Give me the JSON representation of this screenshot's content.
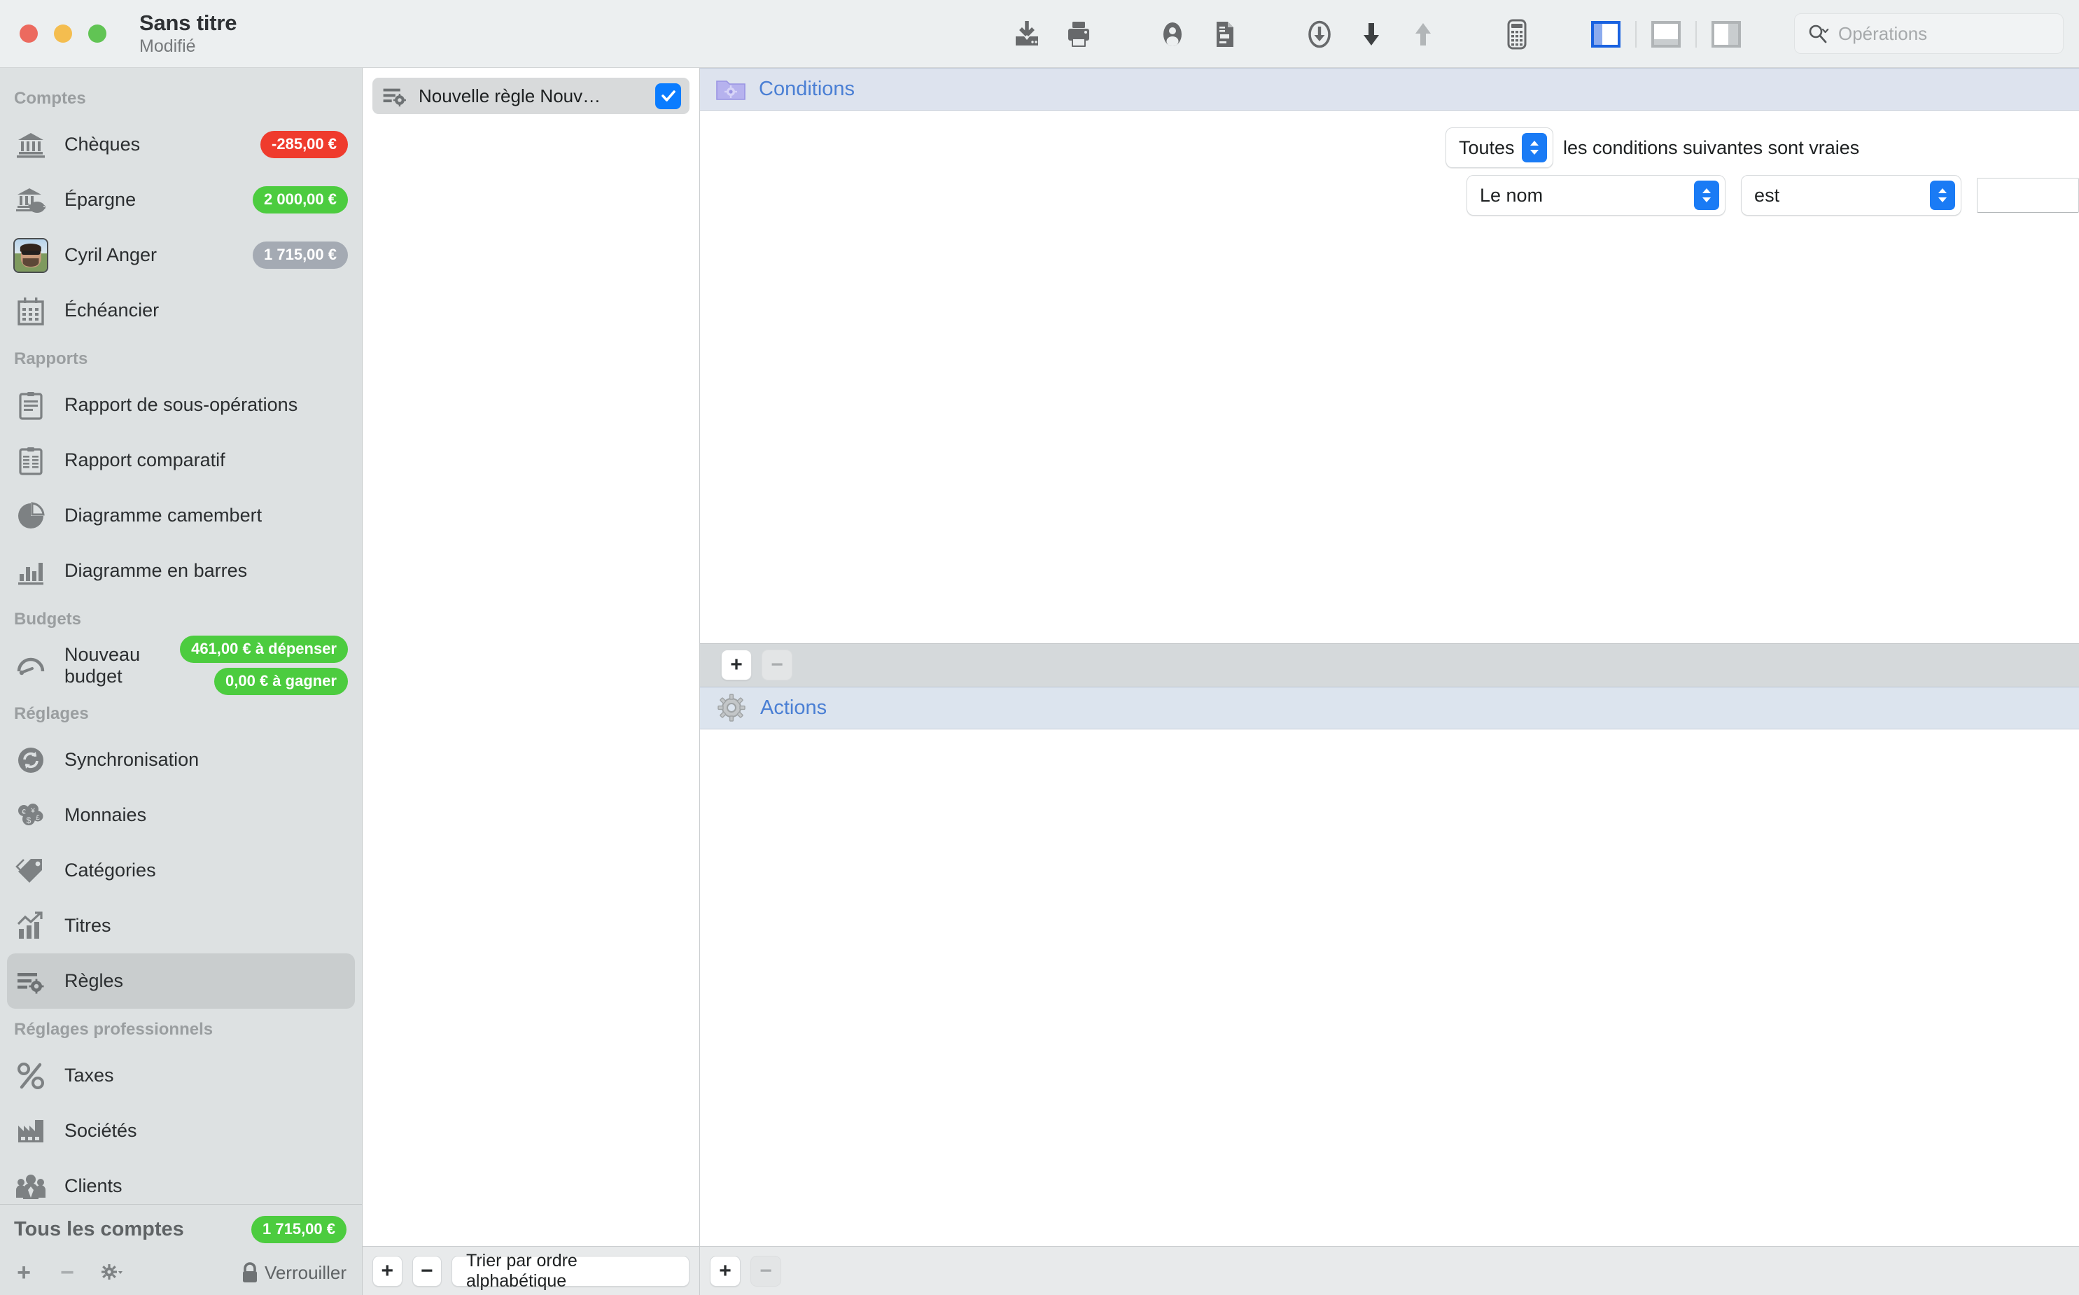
{
  "window": {
    "title": "Sans titre",
    "subtitle": "Modifié",
    "controls": [
      "close",
      "minimize",
      "zoom"
    ]
  },
  "toolbar": {
    "buttons": [
      {
        "name": "import-icon",
        "label": "Importer"
      },
      {
        "name": "print-icon",
        "label": "Imprimer"
      },
      {
        "name": "contact-icon",
        "label": "Contact"
      },
      {
        "name": "document-icon",
        "label": "Document"
      },
      {
        "name": "download-circle-icon",
        "label": "Télécharger"
      },
      {
        "name": "arrow-down-icon",
        "label": "Entrée"
      },
      {
        "name": "arrow-up-icon",
        "label": "Sortie"
      },
      {
        "name": "calculator-icon",
        "label": "Calculatrice"
      }
    ],
    "view_segments": [
      {
        "name": "sidebar-view",
        "selected": true
      },
      {
        "name": "bottom-view",
        "selected": false
      },
      {
        "name": "right-view",
        "selected": false
      }
    ],
    "accent_color": "#1a62e0"
  },
  "search": {
    "placeholder": "Opérations",
    "icon": "search-icon"
  },
  "sidebar": {
    "groups": [
      {
        "label": "Comptes",
        "items": [
          {
            "label": "Chèques",
            "icon": "bank-icon",
            "badge": "-285,00 €",
            "badge_color": "#ef3b2d",
            "selected": false
          },
          {
            "label": "Épargne",
            "icon": "piggybank-icon",
            "badge": "2 000,00 €",
            "badge_color": "#4ccc3f",
            "selected": false
          },
          {
            "label": "Cyril Anger",
            "icon": "avatar",
            "badge": "1 715,00 €",
            "badge_color": "#a4aab3",
            "selected": false
          },
          {
            "label": "Échéancier",
            "icon": "calendar-icon",
            "badge": "",
            "badge_color": "",
            "selected": false
          }
        ]
      },
      {
        "label": "Rapports",
        "items": [
          {
            "label": "Rapport de sous-opérations",
            "icon": "clipboard-icon",
            "badge": "",
            "selected": false
          },
          {
            "label": "Rapport comparatif",
            "icon": "clipboard-split-icon",
            "badge": "",
            "selected": false
          },
          {
            "label": "Diagramme camembert",
            "icon": "pie-chart-icon",
            "badge": "",
            "selected": false
          },
          {
            "label": "Diagramme en barres",
            "icon": "bar-chart-icon",
            "badge": "",
            "selected": false
          }
        ]
      },
      {
        "label": "Budgets",
        "items": [
          {
            "label": "Nouveau budget",
            "icon": "gauge-icon",
            "badges": [
              "461,00 € à dépenser",
              "0,00 € à gagner"
            ],
            "badge_color": "#4ccc3f",
            "selected": false
          }
        ]
      },
      {
        "label": "Réglages",
        "items": [
          {
            "label": "Synchronisation",
            "icon": "sync-icon",
            "badge": "",
            "selected": false
          },
          {
            "label": "Monnaies",
            "icon": "coins-icon",
            "badge": "",
            "selected": false
          },
          {
            "label": "Catégories",
            "icon": "tag-icon",
            "badge": "",
            "selected": false
          },
          {
            "label": "Titres",
            "icon": "stocks-icon",
            "badge": "",
            "selected": false
          },
          {
            "label": "Règles",
            "icon": "rules-icon",
            "badge": "",
            "selected": true
          }
        ]
      },
      {
        "label": "Réglages professionnels",
        "items": [
          {
            "label": "Taxes",
            "icon": "percent-icon",
            "badge": "",
            "selected": false
          },
          {
            "label": "Sociétés",
            "icon": "factory-icon",
            "badge": "",
            "selected": false
          },
          {
            "label": "Clients",
            "icon": "people-icon",
            "badge": "",
            "selected": false
          }
        ]
      }
    ],
    "footer": {
      "total_label": "Tous les comptes",
      "total_value": "1 715,00 €",
      "total_color": "#4ccc3f",
      "add_label": "+",
      "remove_label": "−",
      "gear_label": "⚙",
      "lock_label": "Verrouiller"
    }
  },
  "rules_list": {
    "rows": [
      {
        "name": "Nouvelle règle Nouv…",
        "icon": "rules-icon",
        "enabled": true,
        "selected": true
      }
    ],
    "toolbar": {
      "add_label": "+",
      "remove_label": "−",
      "sort_label": "Trier par ordre alphabétique"
    }
  },
  "detail": {
    "conditions": {
      "title": "Conditions",
      "icon": "conditions-folder-icon",
      "match_mode": "Toutes",
      "match_sentence": "les conditions suivantes sont vraies",
      "rows": [
        {
          "field": "Le nom",
          "operator": "est",
          "value": ""
        }
      ],
      "toolbar": {
        "add_label": "+",
        "remove_label": "−"
      }
    },
    "actions": {
      "title": "Actions",
      "icon": "gear-icon",
      "rows": [],
      "toolbar": {
        "add_label": "+",
        "remove_label": "−"
      }
    }
  }
}
